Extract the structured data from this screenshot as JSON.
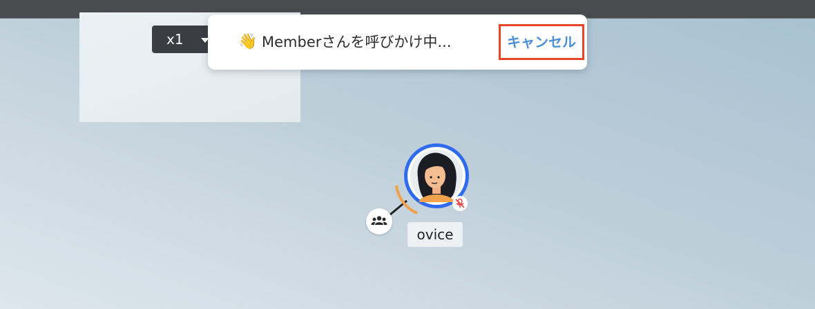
{
  "zoom": {
    "label": "x1"
  },
  "toast": {
    "icon": "waving-hand-icon",
    "emoji": "👋",
    "message": "Memberさんを呼びかけ中...",
    "cancel_label": "キャンセル"
  },
  "user": {
    "name": "ovice",
    "status": "muted"
  },
  "colors": {
    "top_bar": "#494b4f",
    "zoom_control_bg": "#3a3d42",
    "cancel_text": "#4a90d9",
    "highlight_border": "#e8432b",
    "avatar_ring": "#2f6bf0",
    "mute_icon": "#e8433d",
    "voice_range_arc": "#f0a24a"
  }
}
